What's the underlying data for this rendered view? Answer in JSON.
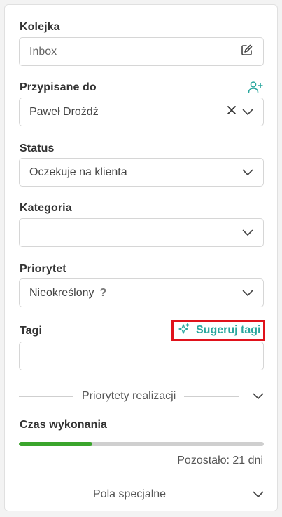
{
  "queue": {
    "label": "Kolejka",
    "value": "Inbox",
    "edit_icon": "edit-icon"
  },
  "assigned": {
    "label": "Przypisane do",
    "value": "Paweł Drożdż",
    "add_icon": "add-user-icon"
  },
  "status": {
    "label": "Status",
    "value": "Oczekuje na klienta"
  },
  "category": {
    "label": "Kategoria",
    "value": ""
  },
  "priority": {
    "label": "Priorytet",
    "value": "Nieokreślony",
    "help": "?"
  },
  "tags": {
    "label": "Tagi",
    "suggest_label": "Sugeruj tagi",
    "value": ""
  },
  "sections": {
    "priorities": "Priorytety realizacji",
    "special": "Pola specjalne"
  },
  "time": {
    "label": "Czas wykonania",
    "progress_fraction": 0.3,
    "remaining": "Pozostało: 21 dni"
  },
  "colors": {
    "accent": "#2aa79e",
    "progress": "#3aa52c",
    "highlight": "#e0121b"
  }
}
